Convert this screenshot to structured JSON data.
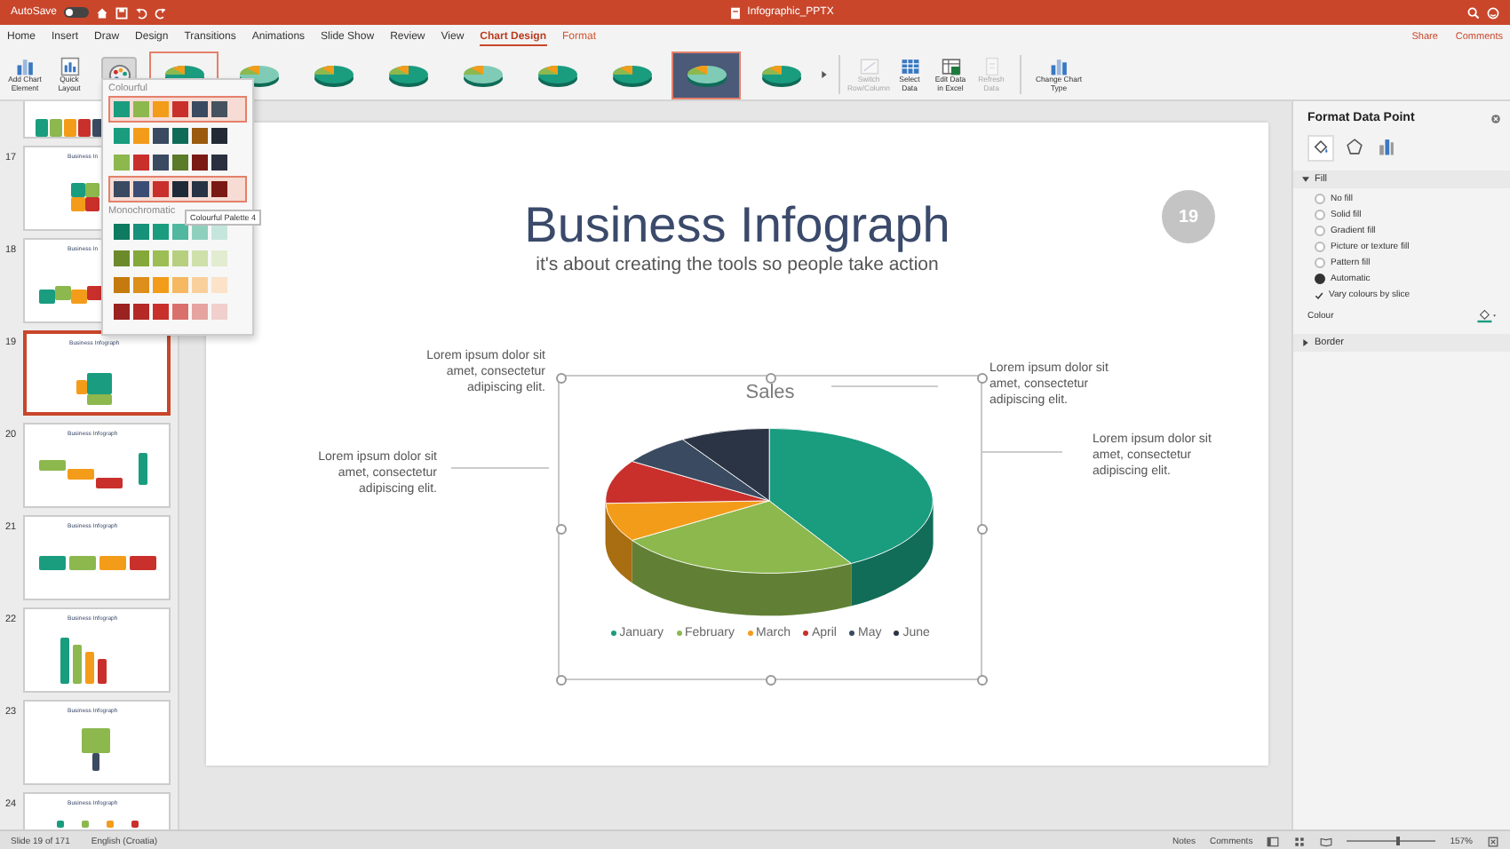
{
  "title_bar": {
    "autosave_label": "AutoSave",
    "autosave_on": false,
    "document_title": "Infographic_PPTX"
  },
  "ribbon_tabs": [
    {
      "label": "Home",
      "selected": false,
      "contextual": false
    },
    {
      "label": "Insert",
      "selected": false,
      "contextual": false
    },
    {
      "label": "Draw",
      "selected": false,
      "contextual": false
    },
    {
      "label": "Design",
      "selected": false,
      "contextual": false
    },
    {
      "label": "Transitions",
      "selected": false,
      "contextual": false
    },
    {
      "label": "Animations",
      "selected": false,
      "contextual": false
    },
    {
      "label": "Slide Show",
      "selected": false,
      "contextual": false
    },
    {
      "label": "Review",
      "selected": false,
      "contextual": false
    },
    {
      "label": "View",
      "selected": false,
      "contextual": false
    },
    {
      "label": "Chart Design",
      "selected": true,
      "contextual": true
    },
    {
      "label": "Format",
      "selected": false,
      "contextual": true
    }
  ],
  "ribbon_actions": {
    "share": "Share",
    "comments": "Comments"
  },
  "chart_buttons": [
    {
      "label": "Add Chart Element",
      "kind": "element"
    },
    {
      "label": "Quick Layout",
      "kind": "layout"
    }
  ],
  "chart_styles": [
    {
      "outlined": true,
      "dark": false
    },
    {
      "outlined": false,
      "dark": false
    },
    {
      "outlined": false,
      "dark": false
    },
    {
      "outlined": false,
      "dark": false
    },
    {
      "outlined": false,
      "dark": false
    },
    {
      "outlined": false,
      "dark": false
    },
    {
      "outlined": false,
      "dark": false
    },
    {
      "outlined": true,
      "dark": true
    },
    {
      "outlined": false,
      "dark": false
    }
  ],
  "data_buttons": [
    {
      "label": "Switch Row/Column",
      "kind": "switch",
      "disabled": true
    },
    {
      "label": "Select Data",
      "kind": "select",
      "disabled": false
    },
    {
      "label": "Edit Data in Excel",
      "kind": "edit",
      "disabled": false
    },
    {
      "label": "Refresh Data",
      "kind": "refresh",
      "disabled": true
    }
  ],
  "type_button": {
    "label": "Change Chart Type"
  },
  "colour_menu": {
    "colourful_heading": "Colourful",
    "monochromatic_heading": "Monochromatic",
    "tooltip": "Colourful Palette 4",
    "colourful": [
      {
        "highlighted": true,
        "swatches": [
          {
            "color": "#1a9c7f"
          },
          {
            "color": "#8cb84e"
          },
          {
            "color": "#f39c1a"
          },
          {
            "color": "#c9302c"
          },
          {
            "color": "#3a4a60"
          },
          {
            "color": "#46525f"
          }
        ]
      },
      {
        "highlighted": false,
        "swatches": [
          {
            "color": "#1a9c7f"
          },
          {
            "color": "#f39c1a"
          },
          {
            "color": "#3a4a60"
          },
          {
            "color": "#0e6b57"
          },
          {
            "color": "#9b5a0e"
          },
          {
            "color": "#232a36"
          }
        ]
      },
      {
        "highlighted": false,
        "swatches": [
          {
            "color": "#8cb84e"
          },
          {
            "color": "#c9302c"
          },
          {
            "color": "#3a4a60"
          },
          {
            "color": "#5b7a2a"
          },
          {
            "color": "#7a1a14"
          },
          {
            "color": "#2a3040"
          }
        ]
      },
      {
        "highlighted": true,
        "swatches": [
          {
            "color": "#3a4a60"
          },
          {
            "color": "#3b4d75"
          },
          {
            "color": "#c9302c"
          },
          {
            "color": "#1e2a38"
          },
          {
            "color": "#283444"
          },
          {
            "color": "#7a1a14"
          }
        ]
      }
    ],
    "monochromatic": [
      {
        "highlighted": false,
        "swatches": [
          {
            "color": "#0e7a60"
          },
          {
            "color": "#16917a"
          },
          {
            "color": "#1a9c7f"
          },
          {
            "color": "#4fb89e"
          },
          {
            "color": "#8fd0bd"
          },
          {
            "color": "#c5e6dc"
          }
        ]
      },
      {
        "highlighted": false,
        "swatches": [
          {
            "color": "#6b8a2a"
          },
          {
            "color": "#85a83a"
          },
          {
            "color": "#9cbe55"
          },
          {
            "color": "#b6d07f"
          },
          {
            "color": "#cfe0aa"
          },
          {
            "color": "#e2ecd0"
          }
        ]
      },
      {
        "highlighted": false,
        "swatches": [
          {
            "color": "#c57a10"
          },
          {
            "color": "#de8e1a"
          },
          {
            "color": "#f39c1a"
          },
          {
            "color": "#f6b860"
          },
          {
            "color": "#f9d09c"
          },
          {
            "color": "#fbe2c8"
          }
        ]
      },
      {
        "highlighted": false,
        "swatches": [
          {
            "color": "#9a2220"
          },
          {
            "color": "#b52a26"
          },
          {
            "color": "#c9302c"
          },
          {
            "color": "#d9706b"
          },
          {
            "color": "#e6a4a0"
          },
          {
            "color": "#f0cfcc"
          }
        ]
      }
    ]
  },
  "slides": [
    {
      "kind": "fan",
      "selected": false
    },
    {
      "number": "17",
      "title": "Business In",
      "kind": "radar",
      "selected": false
    },
    {
      "number": "18",
      "title": "Business In",
      "kind": "arc",
      "selected": false
    },
    {
      "number": "19",
      "title": "Business Infograph",
      "kind": "pie",
      "selected": true
    },
    {
      "number": "20",
      "title": "Business Infograph",
      "kind": "arrows",
      "selected": false
    },
    {
      "number": "21",
      "title": "Business Infograph",
      "kind": "chevrons",
      "selected": false
    },
    {
      "number": "22",
      "title": "Business Infograph",
      "kind": "stairs",
      "selected": false
    },
    {
      "number": "23",
      "title": "Business Infograph",
      "kind": "tree",
      "selected": false
    },
    {
      "number": "24",
      "title": "Business Infograph",
      "kind": "icons",
      "selected": false
    }
  ],
  "slide": {
    "title": "Business Infograph",
    "subtitle": "it's about creating the tools so people take action",
    "badge": "19",
    "callouts": [
      "Lorem ipsum dolor sit amet, consectetur adipiscing elit.",
      "Lorem ipsum dolor sit amet, consectetur adipiscing elit.",
      "Lorem ipsum dolor sit amet, consectetur adipiscing elit.",
      "Lorem ipsum dolor sit amet, consectetur adipiscing elit."
    ],
    "chart": {
      "title": "Sales",
      "legend": [
        {
          "label": "January",
          "color": "#1a9c7f"
        },
        {
          "label": "February",
          "color": "#8cb84e"
        },
        {
          "label": "March",
          "color": "#f39c1a"
        },
        {
          "label": "April",
          "color": "#c9302c"
        },
        {
          "label": "May",
          "color": "#3a4a60"
        },
        {
          "label": "June",
          "color": "#2b3444"
        }
      ]
    }
  },
  "format_pane": {
    "title": "Format Data Point",
    "fill_heading": "Fill",
    "fill_expanded": true,
    "fill_options": [
      {
        "label": "No fill",
        "selected": false
      },
      {
        "label": "Solid fill",
        "selected": false
      },
      {
        "label": "Gradient fill",
        "selected": false
      },
      {
        "label": "Picture or texture fill",
        "selected": false
      },
      {
        "label": "Pattern fill",
        "selected": false
      },
      {
        "label": "Automatic",
        "selected": true
      }
    ],
    "vary_colours": {
      "label": "Vary colours by slice",
      "checked": true
    },
    "colour_label": "Colour",
    "border_heading": "Border",
    "border_expanded": false
  },
  "status_bar": {
    "slide_info": "Slide 19 of 171",
    "language": "English (Croatia)",
    "notes": "Notes",
    "comments": "Comments",
    "zoom": "157%",
    "zoom_level": {
      "level": 0.55
    }
  }
}
